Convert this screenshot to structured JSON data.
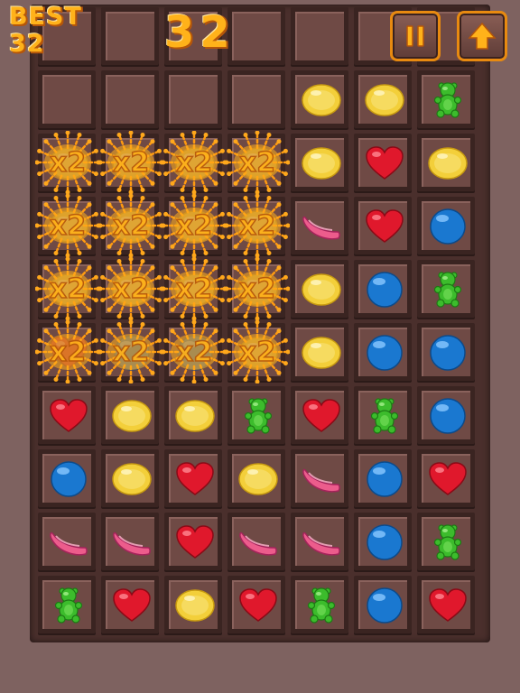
{
  "hud": {
    "best_label": "BEST",
    "best_value": "32",
    "score": "32",
    "pause_icon": "pause-icon",
    "up_icon": "up-arrow-icon"
  },
  "board": {
    "rows": [
      [
        "empty",
        "empty",
        "empty",
        "empty",
        "empty",
        "empty",
        "empty"
      ],
      [
        "empty",
        "empty",
        "empty",
        "empty",
        "yellow",
        "yellow",
        "bear"
      ],
      [
        "x2",
        "x2",
        "x2",
        "x2",
        "yellow",
        "heart",
        "yellow"
      ],
      [
        "x2",
        "x2",
        "x2",
        "x2",
        "jelly",
        "heart",
        "blue"
      ],
      [
        "x2",
        "x2",
        "x2",
        "x2",
        "yellow",
        "blue",
        "bear"
      ],
      [
        "x2-heart",
        "x2-blue",
        "x2-blue",
        "x2-yellow",
        "yellow",
        "blue",
        "blue"
      ],
      [
        "heart",
        "yellow",
        "yellow",
        "bear",
        "heart",
        "bear",
        "blue"
      ],
      [
        "blue",
        "yellow",
        "heart",
        "yellow",
        "jelly",
        "blue",
        "heart"
      ],
      [
        "jelly",
        "jelly",
        "heart",
        "jelly",
        "jelly",
        "blue",
        "bear"
      ],
      [
        "bear",
        "heart",
        "yellow",
        "heart",
        "bear",
        "blue",
        "heart"
      ]
    ]
  },
  "boost_label": "x2",
  "colors": {
    "heart": "#e0182c",
    "yellow": "#f3cf3a",
    "blue": "#1a78d0",
    "jelly": "#ec5c8c",
    "bear": "#3cbc2c",
    "gold": "#ffb21a"
  }
}
